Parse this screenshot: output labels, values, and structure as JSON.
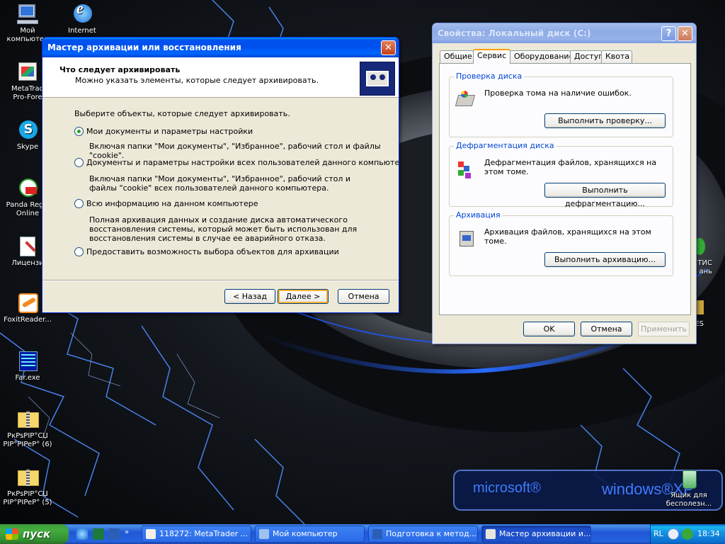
{
  "desktop": {
    "icons": [
      {
        "label": "Мой\nкомпьютер",
        "icon": "my-computer-icon"
      },
      {
        "label": "Internet",
        "icon": "internet-explorer-icon"
      },
      {
        "label": "MetaTrad\nPro-Fore",
        "icon": "metatrader-icon"
      },
      {
        "label": "Skype",
        "icon": "skype-icon"
      },
      {
        "label": "Panda Regis\nOnline",
        "icon": "panda-icon"
      },
      {
        "label": "Лицензи",
        "icon": "license-icon"
      },
      {
        "label": "FoxitReader...",
        "icon": "foxit-icon"
      },
      {
        "label": "Far.exe",
        "icon": "far-icon"
      },
      {
        "label": "PкPsPIP°CЏ\nPIP°PIPeP° (6)",
        "icon": "zip-folder-icon"
      },
      {
        "label": "PкPsPIP°CЏ\nPIP°PIPeP° (5)",
        "icon": "zip-folder-icon"
      },
      {
        "label": "Ящик для\nбесполезн...",
        "icon": "recycle-bin-icon"
      },
      {
        "label": "ТИС\nань",
        "icon": "partial-icon"
      },
      {
        "label": "ES",
        "icon": "partial-icon"
      }
    ],
    "watermark": {
      "left": "microsoft®",
      "right": "windows®XP"
    }
  },
  "wizard": {
    "title": "Мастер архивации или восстановления",
    "header_title": "Что следует архивировать",
    "header_subtitle": "Можно указать элементы, которые следует архивировать.",
    "prompt": "Выберите объекты, которые следует архивировать.",
    "options": [
      {
        "label": "Мои документы и параметры настройки",
        "selected": true,
        "description": "Включая папки \"Мои документы\", \"Избранное\", рабочий стол и файлы \"cookie\"."
      },
      {
        "label": "Документы и параметры настройки всех пользователей данного компьютера",
        "selected": false,
        "description": "Включая папки \"Мои документы\", \"Избранное\", рабочий стол и файлы \"cookie\" всех пользователей данного компьютера."
      },
      {
        "label": "Всю информацию на данном компьютере",
        "selected": false,
        "description": "Полная архивация данных и создание диска автоматического восстановления системы, который может быть использован для восстановления системы в случае ее аварийного отказа."
      },
      {
        "label": "Предоставить возможность выбора объектов для архивации",
        "selected": false,
        "description": ""
      }
    ],
    "buttons": {
      "back": "< Назад",
      "next": "Далее >",
      "cancel": "Отмена"
    }
  },
  "properties": {
    "title": "Свойства: Локальный диск (C:)",
    "tabs": [
      "Общие",
      "Сервис",
      "Оборудование",
      "Доступ",
      "Квота"
    ],
    "selected_tab": "Сервис",
    "groups": [
      {
        "label": "Проверка диска",
        "text": "Проверка тома на наличие ошибок.",
        "button": "Выполнить проверку..."
      },
      {
        "label": "Дефрагментация диска",
        "text": "Дефрагментация файлов, хранящихся на этом томе.",
        "button": "Выполнить дефрагментацию..."
      },
      {
        "label": "Архивация",
        "text": "Архивация файлов, хранящихся на этом томе.",
        "button": "Выполнить архивацию..."
      }
    ],
    "buttons": {
      "ok": "OK",
      "cancel": "Отмена",
      "apply": "Применить"
    }
  },
  "taskbar": {
    "start_label": "пуск",
    "tasks": [
      {
        "label": "118272: MetaTrader ...",
        "pressed": false
      },
      {
        "label": "Мой компьютер",
        "pressed": false
      },
      {
        "label": "Подготовка к метод...",
        "pressed": false
      },
      {
        "label": "Мастер архивации и...",
        "pressed": true
      }
    ],
    "tray": {
      "language": "RL",
      "clock": "18:34"
    }
  },
  "colors": {
    "accent": "#0054e3",
    "start_green": "#3c9b3a",
    "group_label": "#0046d5",
    "radio_dot": "#21a121"
  }
}
